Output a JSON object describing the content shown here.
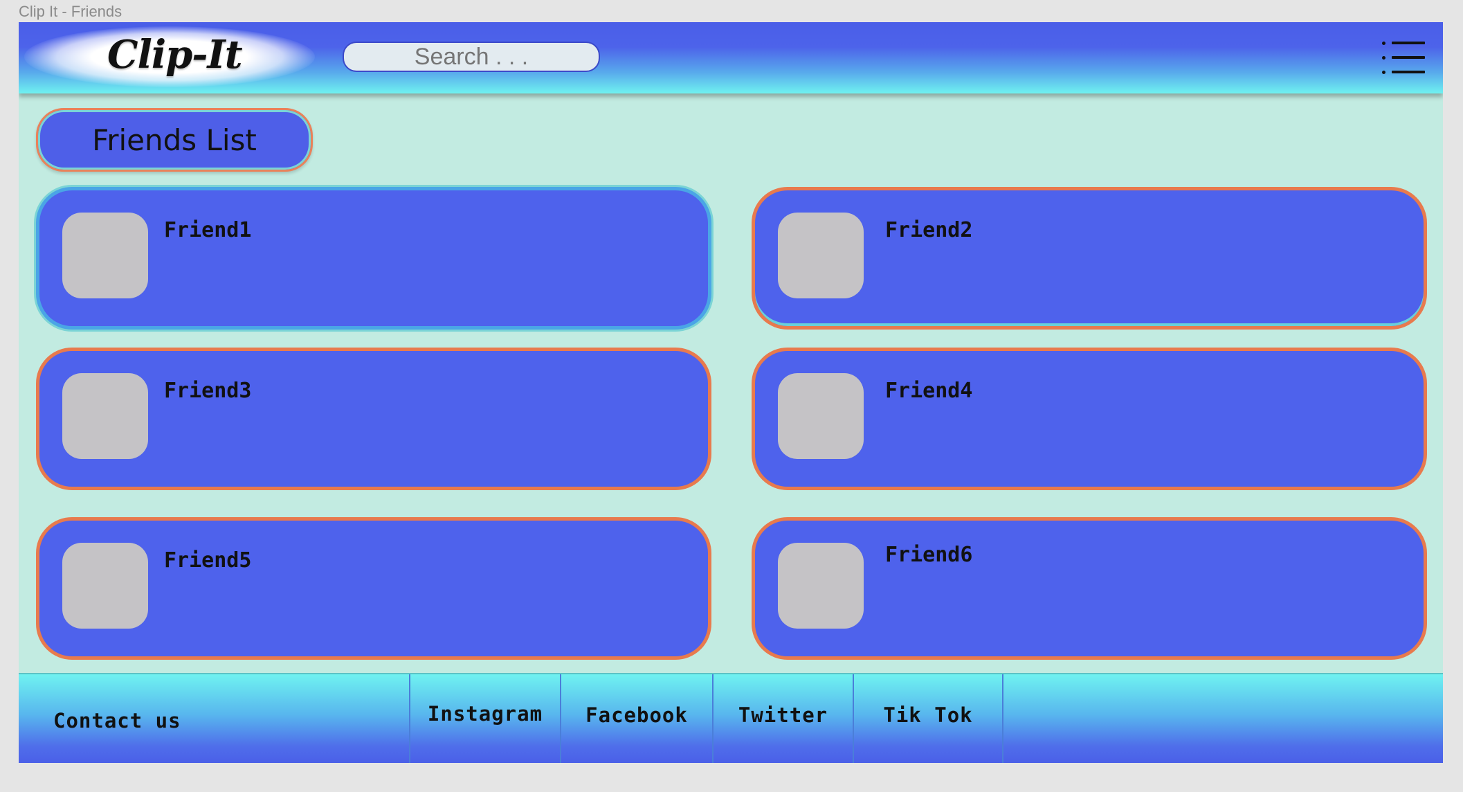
{
  "window": {
    "title": "Clip It - Friends"
  },
  "header": {
    "logo": "Clip-It",
    "search_placeholder": "Search . . .",
    "menu_icon": "hamburger-menu-icon"
  },
  "main": {
    "title": "Friends List",
    "friends": [
      {
        "name": "Friend1"
      },
      {
        "name": "Friend2"
      },
      {
        "name": "Friend3"
      },
      {
        "name": "Friend4"
      },
      {
        "name": "Friend5"
      },
      {
        "name": "Friend6"
      }
    ]
  },
  "footer": {
    "contact": "Contact us",
    "links": [
      "Instagram",
      "Facebook",
      "Twitter",
      "Tik Tok"
    ]
  },
  "colors": {
    "header_blue": "#4a5ee8",
    "header_cyan": "#6ff2f0",
    "background": "#c2ebe1",
    "card_blue": "#4e62ec",
    "card_border_orange": "#e87a4d",
    "card_border_selected": "#4aa5e6",
    "avatar_gray": "#c5c3c6"
  }
}
